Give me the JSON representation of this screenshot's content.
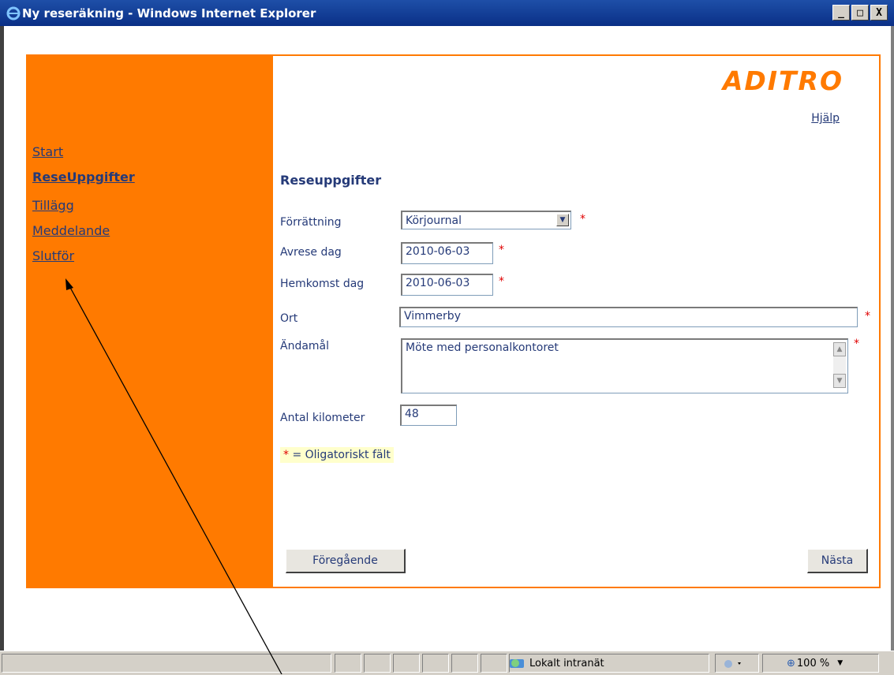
{
  "window": {
    "title": "Ny reseräkning - Windows Internet Explorer",
    "buttons": [
      "_",
      "□",
      "X"
    ]
  },
  "sidebar": {
    "items": [
      {
        "label": "Start",
        "active": false
      },
      {
        "label": "ReseUppgifter",
        "active": true
      },
      {
        "label": "Tillägg",
        "active": false
      },
      {
        "label": "Meddelande",
        "active": false
      },
      {
        "label": "Slutför",
        "active": false
      }
    ]
  },
  "header": {
    "logo": "ADITRO",
    "help": "Hjälp"
  },
  "form": {
    "title": "Reseuppgifter",
    "forrattning": {
      "label": "Förrättning",
      "value": "Körjournal"
    },
    "avrese": {
      "label": "Avrese dag",
      "value": "2010-06-03"
    },
    "hemkomst": {
      "label": "Hemkomst dag",
      "value": "2010-06-03"
    },
    "ort": {
      "label": "Ort",
      "value": "Vimmerby"
    },
    "andamal": {
      "label": "Ändamål",
      "value": "Möte med personalkontoret"
    },
    "kilometer": {
      "label": "Antal kilometer",
      "value": "48"
    },
    "required_mark": "*",
    "legend_text": "= Oligatoriskt fält"
  },
  "buttons": {
    "previous": "Föregående",
    "next": "Nästa"
  },
  "statusbar": {
    "zone": "Lokalt intranät",
    "zoom": "100 %"
  },
  "colors": {
    "accent": "#ff7a00",
    "text": "#253a78",
    "required": "#e00000"
  }
}
